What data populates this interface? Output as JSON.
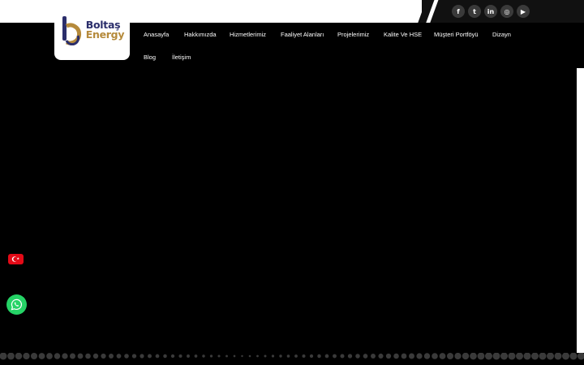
{
  "brand": {
    "name_line1": "Boltaş",
    "name_line2": "Energy",
    "navy": "#2b2e6b",
    "gold": "#b58a3b"
  },
  "social": [
    {
      "name": "facebook-icon",
      "glyph": "f"
    },
    {
      "name": "twitter-icon",
      "glyph": "t"
    },
    {
      "name": "linkedin-icon",
      "glyph": "in"
    },
    {
      "name": "instagram-icon",
      "glyph": "◎"
    },
    {
      "name": "youtube-icon",
      "glyph": "▶"
    }
  ],
  "nav": {
    "items": [
      {
        "label": "Anasayfa"
      },
      {
        "label": "Hakkımızda"
      },
      {
        "label": "Hizmetlerimiz"
      },
      {
        "label": "Faaliyet Alanları"
      },
      {
        "label": "Projelerimiz"
      },
      {
        "label": "Kalite Ve HSE"
      },
      {
        "label": "Müşteri Portföyü"
      },
      {
        "label": "Dizayn"
      },
      {
        "label": "Blog"
      },
      {
        "label": "İletişim"
      }
    ]
  },
  "widgets": {
    "language_flag": "turkish-flag-icon",
    "whatsapp": "whatsapp-icon",
    "whatsapp_color": "#25d366"
  }
}
